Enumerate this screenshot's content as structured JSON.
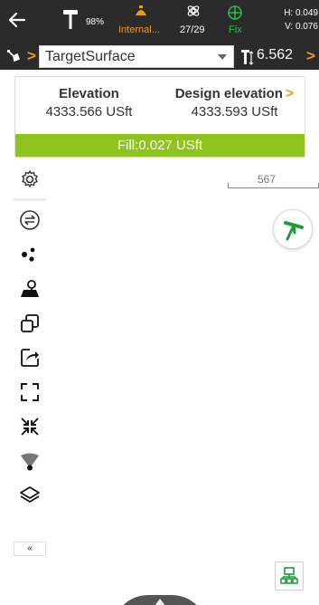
{
  "status_bar": {
    "battery": "98%",
    "link_label": "Internal...",
    "satellites": "27/29",
    "solution": "Fix",
    "h_precision": "H: 0.049",
    "v_precision": "V: 0.076",
    "colors": {
      "background": "#2b2b2b",
      "link": "#f39a1b",
      "fix": "#2dbe4a"
    }
  },
  "target_bar": {
    "surface": "TargetSurface",
    "antenna_height": "6.562",
    "accent": "#f39a1b"
  },
  "elevation_card": {
    "elevation_label": "Elevation",
    "elevation_value": "4333.566 USft",
    "design_label": "Design elevation",
    "design_arrow": ">",
    "design_value": "4333.593 USft",
    "fill_text": "Fill:0.027 USft",
    "fill_color": "#8fc41e"
  },
  "map": {
    "scale_value": "567"
  },
  "toolbar": {
    "items": [
      "settings-icon",
      "swap-icon",
      "points-icon",
      "map-location-icon",
      "layers-frame-icon",
      "export-icon",
      "fit-extent-icon",
      "collapse-arrows-icon",
      "signal-icon",
      "layers-icon"
    ],
    "collapse_label": "«"
  }
}
